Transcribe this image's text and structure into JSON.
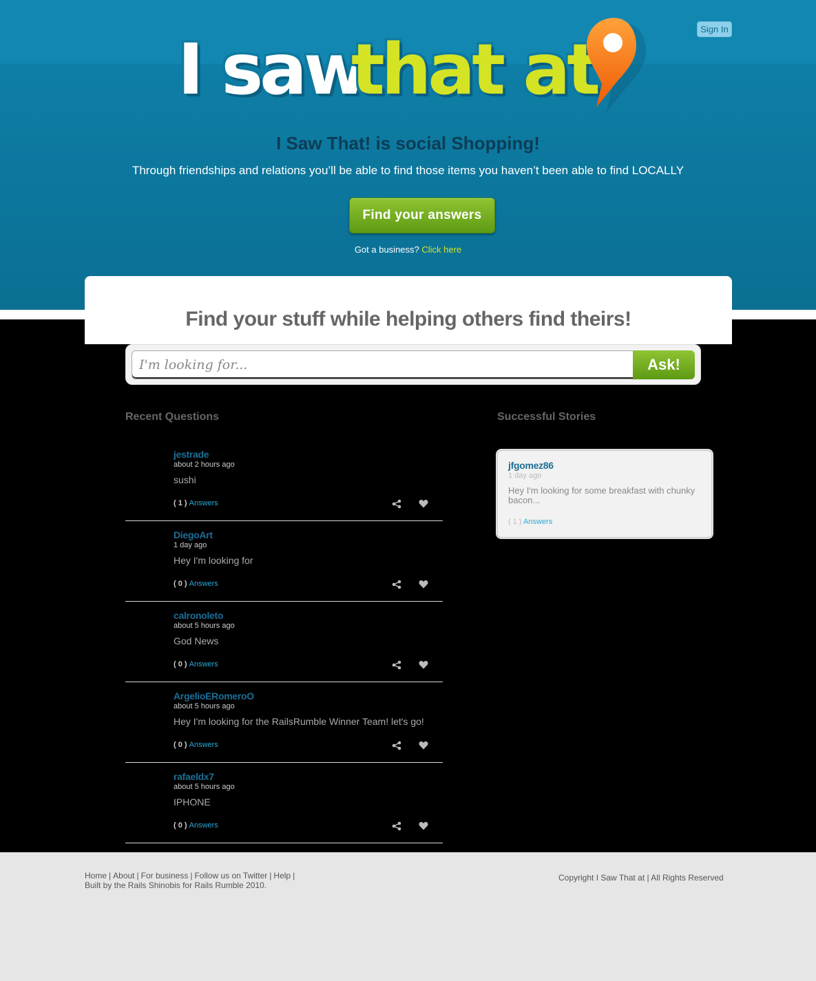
{
  "header": {
    "signin_label": "Sign In",
    "logo": {
      "word1": "I saw",
      "word2": "that at"
    },
    "tagline": "I Saw That! is social Shopping!",
    "subline": "Through friendships and relations you’ll be able to find those items you haven’t been able to find LOCALLY",
    "cta_label": "Find your answers",
    "business_prefix": "Got a business?",
    "business_link": "Click here"
  },
  "panel": {
    "heading": "Find your stuff while helping others find theirs!"
  },
  "search": {
    "placeholder": "I'm looking for...",
    "value": "",
    "ask_label": "Ask!"
  },
  "recent": {
    "title": "Recent Questions",
    "answers_label": "Answers",
    "items": [
      {
        "user": "jestrade",
        "time": "about 2 hours ago",
        "text": "sushi",
        "count": "( 1 )"
      },
      {
        "user": "DiegoArt",
        "time": "1 day ago",
        "text": "Hey I'm looking for",
        "count": "( 0 )"
      },
      {
        "user": "calronoleto",
        "time": "about 5 hours ago",
        "text": "God News",
        "count": "( 0 )"
      },
      {
        "user": "ArgelioERomeroO",
        "time": "about 5 hours ago",
        "text": "Hey I'm looking for the RailsRumble Winner Team! let's go!",
        "count": "( 0 )"
      },
      {
        "user": "rafaeldx7",
        "time": "about 5 hours ago",
        "text": "IPHONE",
        "count": "( 0 )"
      }
    ]
  },
  "stories": {
    "title": "Successful Stories",
    "items": [
      {
        "user": "jfgomez86",
        "time": "1 day ago",
        "text": "Hey I'm looking for some breakfast with chunky bacon...",
        "count": "( 1 )",
        "answers_label": "Answers"
      }
    ]
  },
  "footer": {
    "links": [
      "Home",
      "About",
      "For business",
      "Follow us on Twitter",
      "Help"
    ],
    "built": "Built by the Rails Shinobis for Rails Rumble 2010.",
    "copyright": "Copyright I Saw That at | All Rights Reserved"
  },
  "colors": {
    "hero_blue": "#1187b1",
    "accent_green": "#6fae1e",
    "logo_yellow": "#d4e425",
    "pin_orange": "#f57a10",
    "username_blue": "#1d6e96",
    "link_cyan": "#2aa7d8"
  }
}
